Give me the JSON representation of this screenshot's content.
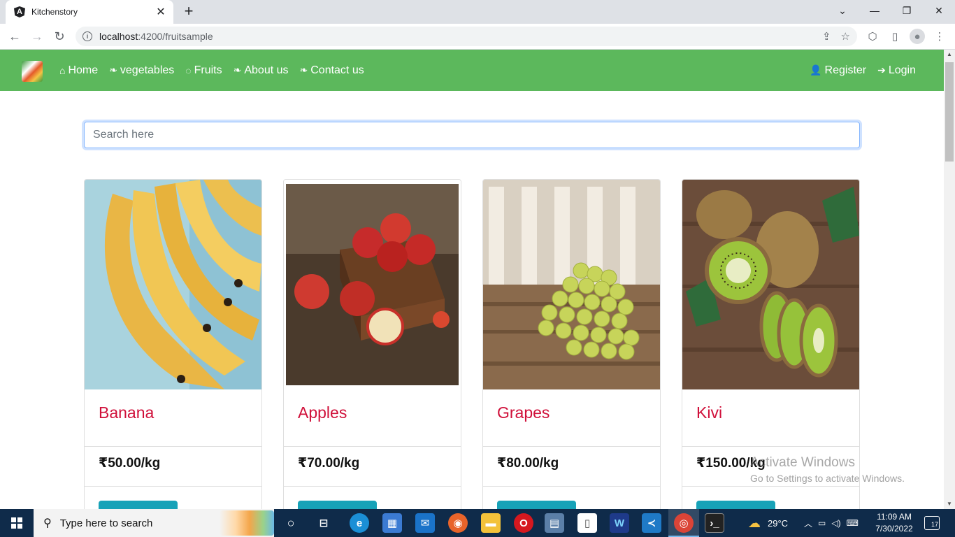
{
  "browser": {
    "tab_title": "Kitchenstory",
    "tab_favicon": "A",
    "new_tab": "+",
    "url_host": "localhost",
    "url_path": ":4200/fruitsample",
    "icons": {
      "back": "←",
      "forward": "→",
      "reload": "↻",
      "info": "i",
      "share": "⇪",
      "star": "☆",
      "extension": "⬡",
      "sidepanel": "▯",
      "profile": "●",
      "menu": "⋮",
      "tab_list": "⌄",
      "minimize": "—",
      "restore": "❐",
      "close": "✕",
      "tab_close": "✕"
    }
  },
  "navbar": {
    "links": [
      {
        "label": "Home",
        "icon": "⌂"
      },
      {
        "label": "vegetables",
        "icon": "❧"
      },
      {
        "label": "Fruits",
        "icon": "◌"
      },
      {
        "label": "About us",
        "icon": "❧"
      },
      {
        "label": "Contact us",
        "icon": "❧"
      }
    ],
    "right_links": [
      {
        "label": "Register",
        "icon": "👤"
      },
      {
        "label": "Login",
        "icon": "➔"
      }
    ],
    "color": "#5cb85c"
  },
  "search": {
    "placeholder": "Search here"
  },
  "products": [
    {
      "name": "Banana",
      "price": "₹50.00/kg"
    },
    {
      "name": "Apples",
      "price": "₹70.00/kg"
    },
    {
      "name": "Grapes",
      "price": "₹80.00/kg"
    },
    {
      "name": "Kivi",
      "price": "₹150.00/kg"
    }
  ],
  "colors": {
    "product_name": "#d0103a",
    "button": "#17a2b8",
    "accent": "#5cb85c"
  },
  "watermark": {
    "line1": "Activate Windows",
    "line2": "Go to Settings to activate Windows."
  },
  "taskbar": {
    "search_text": "Type here to search",
    "weather": "29°C",
    "time": "11:09 AM",
    "date": "7/30/2022",
    "notification_count": "17"
  }
}
